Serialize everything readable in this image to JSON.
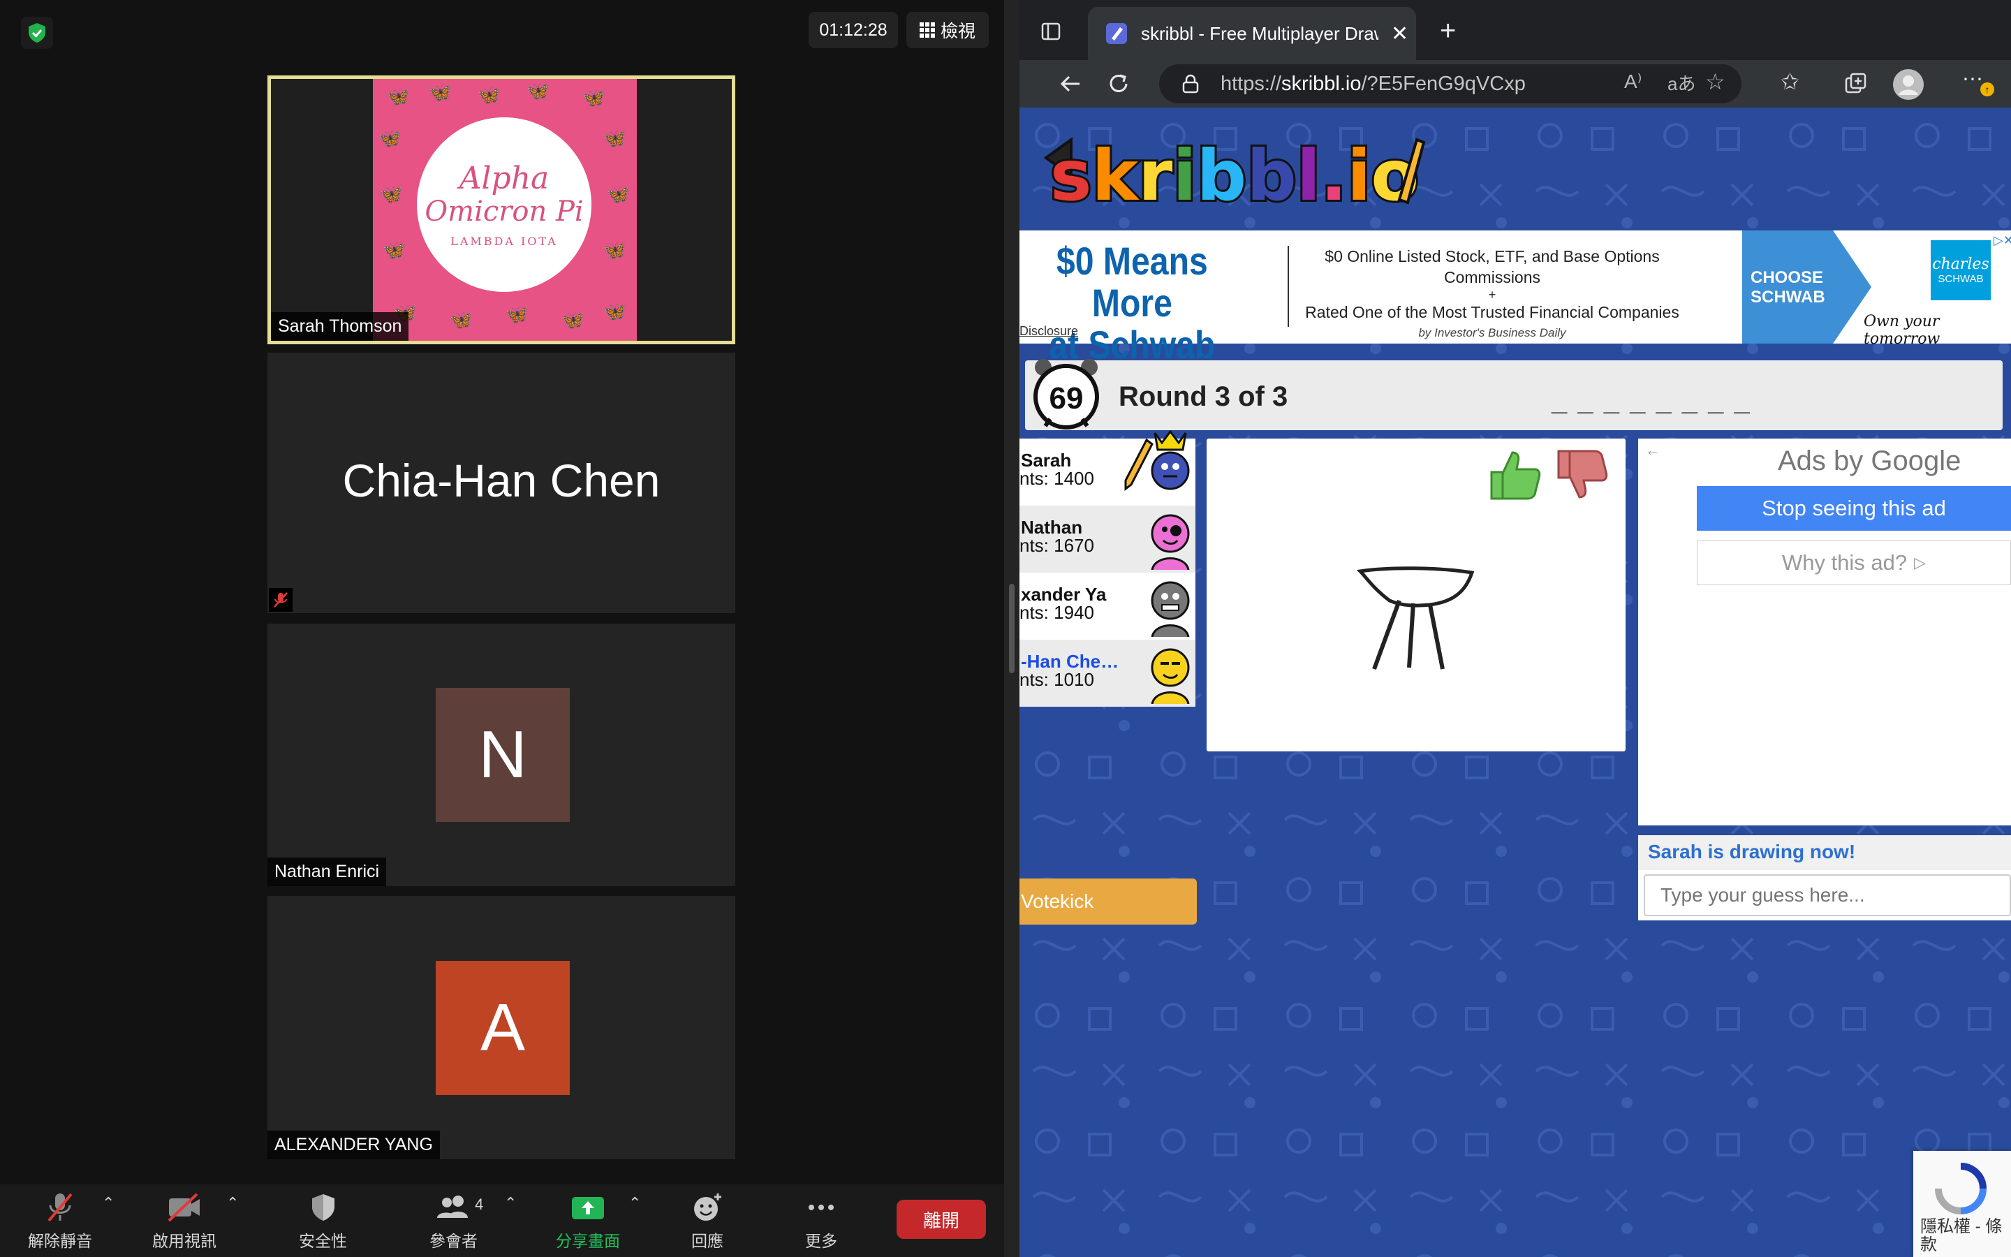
{
  "zoom": {
    "timer": "01:12:28",
    "view_label": "檢視",
    "participants": [
      {
        "name": "Sarah Thomson"
      },
      {
        "name": "Chia-Han Chen"
      },
      {
        "name": "Nathan Enrici",
        "initial": "N",
        "color": "#5f3f39"
      },
      {
        "name": "ALEXANDER YANG",
        "initial": "A",
        "color": "#bf4423"
      }
    ],
    "logo": {
      "line1": "Alpha",
      "line2": "Omicron Pi",
      "line3": "LAMBDA IOTA"
    },
    "toolbar": {
      "unmute": "解除靜音",
      "video": "啟用視訊",
      "security": "安全性",
      "participants": "參會者",
      "participant_count": "4",
      "share": "分享畫面",
      "reactions": "回應",
      "more": "更多",
      "leave": "離開"
    },
    "accent_colors": {
      "active_speaker": "#e3de93",
      "share": "#22b455",
      "leave": "#c4282b"
    }
  },
  "browser": {
    "tab_title": "skribbl - Free Multiplayer Draw",
    "url_prefix": "https://",
    "url_host": "skribbl.io",
    "url_rest": "/?E5FenG9qVCxp"
  },
  "skribbl": {
    "logo_text": "skribbl.io",
    "ad": {
      "headline1": "$0 Means More",
      "headline2": "at Schwab",
      "line1": "$0 Online Listed Stock, ETF, and Base Options Commissions",
      "plus": "+",
      "line2": "Rated One of the Most Trusted Financial Companies",
      "line3": "by Investor's Business Daily",
      "disclosure": "Disclosure",
      "cta1": "CHOOSE",
      "cta2": "SCHWAB",
      "brand1": "charles",
      "brand2": "SCHWAB",
      "tagline": "Own your tomorrow"
    },
    "timer": "69",
    "round": "Round 3 of 3",
    "word_hint": "_ _ _ _ _ _ _ _",
    "players": [
      {
        "name": "Sarah",
        "points": "nts: 1400"
      },
      {
        "name": "Nathan",
        "points": "nts: 1670"
      },
      {
        "name": "xander Ya",
        "points": "nts: 1940"
      },
      {
        "name": "-Han Che…",
        "points": "nts: 1010"
      }
    ],
    "google_ad": {
      "title_prefix": "Ads by ",
      "title_brand": "Google",
      "stop": "Stop seeing this ad",
      "why": "Why this ad?"
    },
    "chat": {
      "status": "Sarah is drawing now!",
      "placeholder": "Type your guess here..."
    },
    "votekick": "Votekick",
    "recaptcha_text": "隱私權 - 條款"
  }
}
